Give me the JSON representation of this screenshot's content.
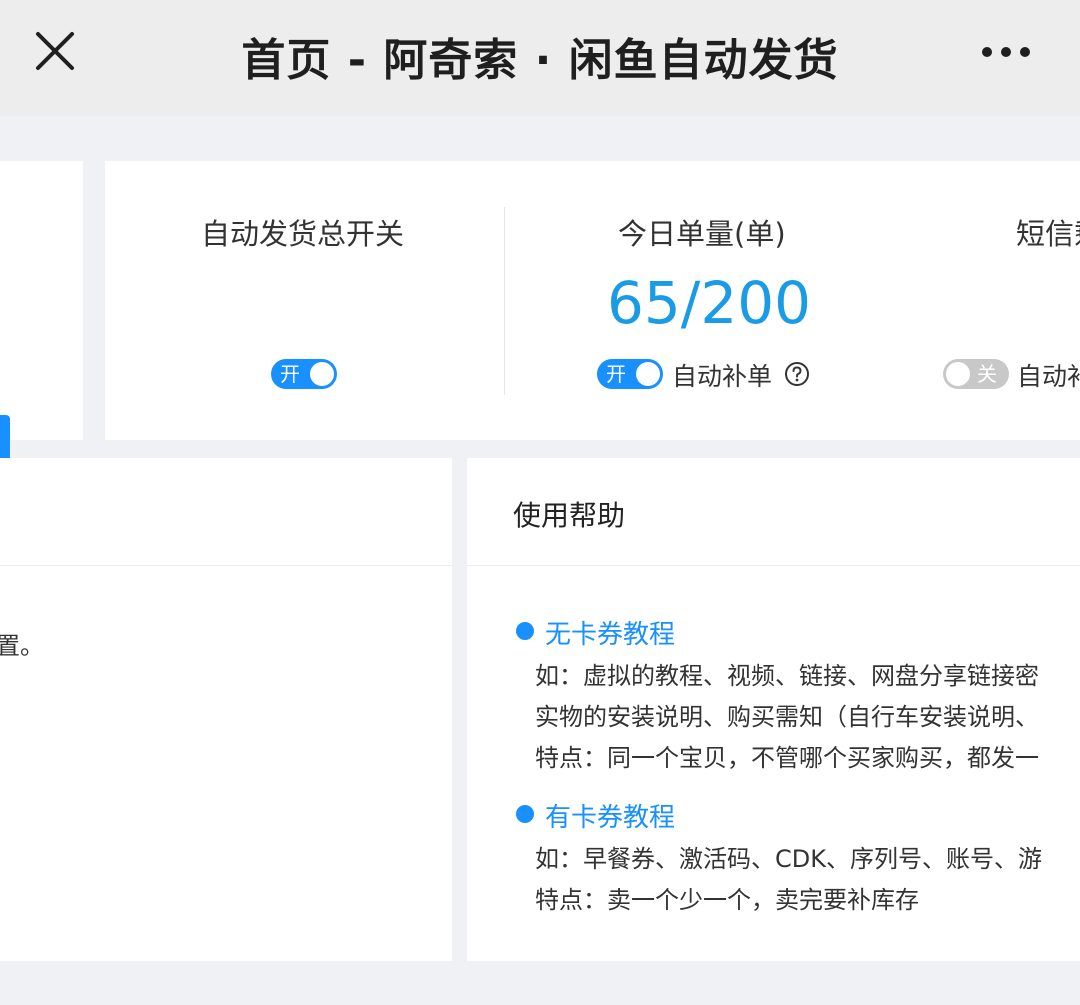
{
  "header": {
    "title": "首页 - 阿奇索 · 闲鱼自动发货"
  },
  "stats": {
    "auto_ship": {
      "label": "自动发货总开关",
      "toggle": "开"
    },
    "today_orders": {
      "label": "今日单量(单)",
      "value": "65/200",
      "toggle": "开",
      "option_label": "自动补单"
    },
    "sms": {
      "label": "短信剩",
      "toggle": "关",
      "option_label": "自动补"
    }
  },
  "left_panel": {
    "snippet": "置。"
  },
  "help": {
    "title": "使用帮助",
    "sections": [
      {
        "title": "无卡券教程",
        "lines": [
          "如：虚拟的教程、视频、链接、网盘分享链接密",
          "实物的安装说明、购买需知（自行车安装说明、",
          "特点：同一个宝贝，不管哪个买家购买，都发一"
        ]
      },
      {
        "title": "有卡券教程",
        "lines": [
          "如：早餐券、激活码、CDK、序列号、账号、游",
          "特点：卖一个少一个，卖完要补库存"
        ]
      }
    ]
  },
  "colors": {
    "accent": "#1890ff",
    "value": "#1a9be6"
  },
  "icons": {
    "close": "close-icon",
    "more": "more-horizontal-icon",
    "help": "question-circle-icon"
  }
}
